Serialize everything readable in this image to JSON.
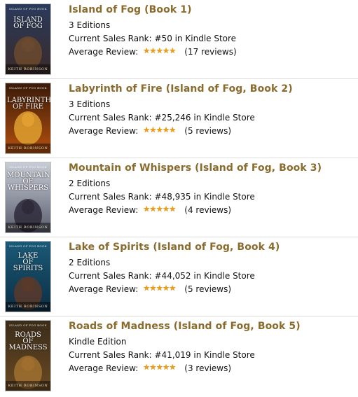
{
  "colors": {
    "title": "#8b6b2c",
    "star": "#ef9f12",
    "separator": "#dcdcdc"
  },
  "books": [
    {
      "title": "Island of Fog (Book 1)",
      "editions": "3 Editions",
      "rank_label": "Current Sales Rank:",
      "rank_value": "#50 in Kindle Store",
      "review_label": "Average Review:",
      "rating": 5,
      "reviews": "(17 reviews)",
      "cover": {
        "series": "Island of Fog Book",
        "title": "ISLAND\nOF FOG",
        "author": "Keith Robinson",
        "bg_top": "#2a3a5c",
        "bg_bottom": "#3a2a2a",
        "accent": "#6b4a2e"
      }
    },
    {
      "title": "Labyrinth of Fire (Island of Fog, Book 2)",
      "editions": "3 Editions",
      "rank_label": "Current Sales Rank:",
      "rank_value": "#25,246 in Kindle Store",
      "review_label": "Average Review:",
      "rating": 5,
      "reviews": "(5 reviews)",
      "cover": {
        "series": "Island of Fog Book",
        "title": "LABYRINTH\nOF FIRE",
        "author": "Keith Robinson",
        "bg_top": "#3a1a08",
        "bg_bottom": "#b3500e",
        "accent": "#e0a030"
      }
    },
    {
      "title": "Mountain of Whispers (Island of Fog, Book 3)",
      "editions": "2 Editions",
      "rank_label": "Current Sales Rank:",
      "rank_value": "#48,935 in Kindle Store",
      "review_label": "Average Review:",
      "rating": 5,
      "reviews": "(4 reviews)",
      "cover": {
        "series": "Island of Fog Book",
        "title": "MOUNTAIN\nOF WHISPERS",
        "author": "Keith Robinson",
        "bg_top": "#c8ccd6",
        "bg_bottom": "#5a5e6e",
        "accent": "#2e2a3a"
      }
    },
    {
      "title": "Lake of Spirits (Island of Fog, Book 4)",
      "editions": "2 Editions",
      "rank_label": "Current Sales Rank:",
      "rank_value": "#44,052 in Kindle Store",
      "review_label": "Average Review:",
      "rating": 5,
      "reviews": "(5 reviews)",
      "cover": {
        "series": "Island of Fog Book",
        "title": "LAKE\nOF SPIRITS",
        "author": "Keith Robinson",
        "bg_top": "#1a5a78",
        "bg_bottom": "#0c2e44",
        "accent": "#5a3a2a"
      }
    },
    {
      "title": "Roads of Madness (Island of Fog, Book 5)",
      "editions": "Kindle Edition",
      "rank_label": "Current Sales Rank:",
      "rank_value": "#41,019 in Kindle Store",
      "review_label": "Average Review:",
      "rating": 4.5,
      "reviews": "(3 reviews)",
      "cover": {
        "series": "Island of Fog Book",
        "title": "ROADS\nOF MADNESS",
        "author": "Keith Robinson",
        "bg_top": "#3a2c1a",
        "bg_bottom": "#6a4a22",
        "accent": "#a07030"
      }
    }
  ]
}
